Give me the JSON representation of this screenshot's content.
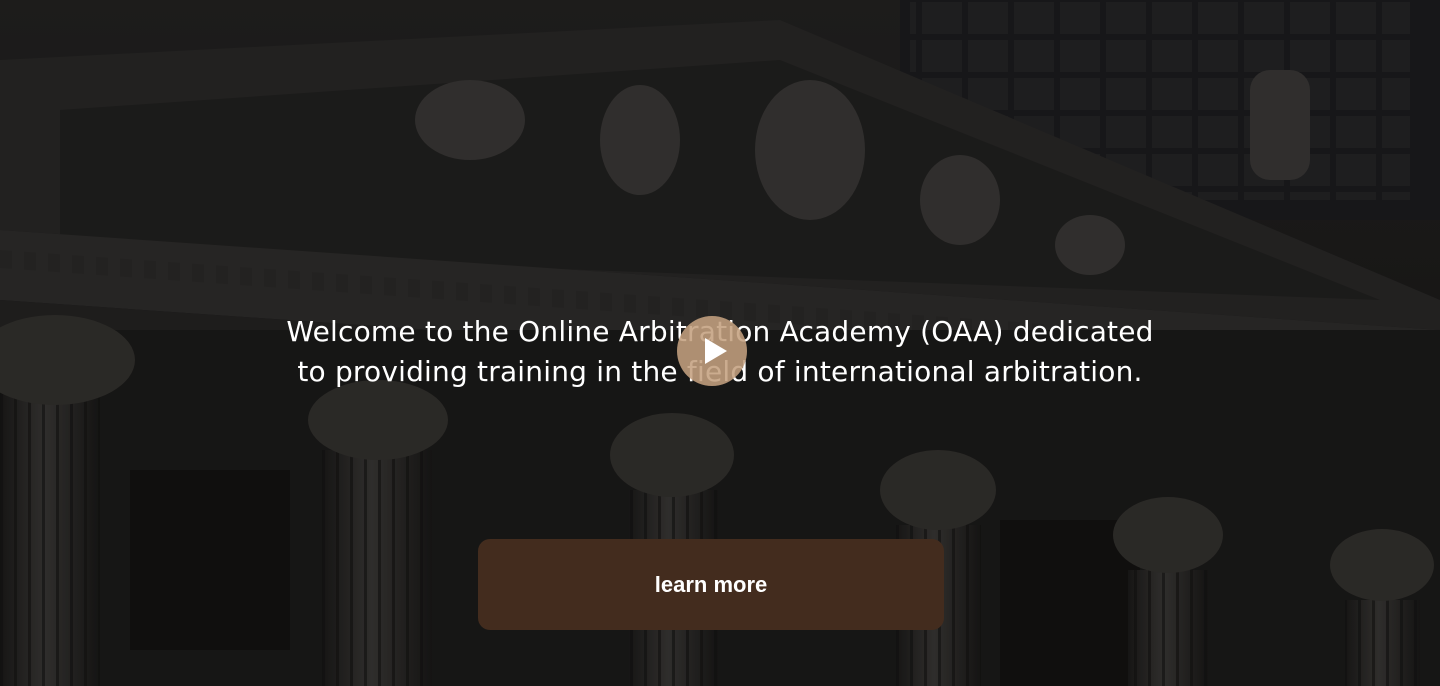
{
  "hero": {
    "headline_line1": "Welcome to the Online Arbitration Academy (OAA) dedicated",
    "headline_line2": "to providing training in the field of international arbitration.",
    "play_icon": "play-icon",
    "cta_label": "learn more",
    "background_image": "neoclassical-courthouse-facade"
  },
  "colors": {
    "play_button": "#c4a080",
    "cta_background": "#432c1e",
    "text": "#ffffff"
  }
}
